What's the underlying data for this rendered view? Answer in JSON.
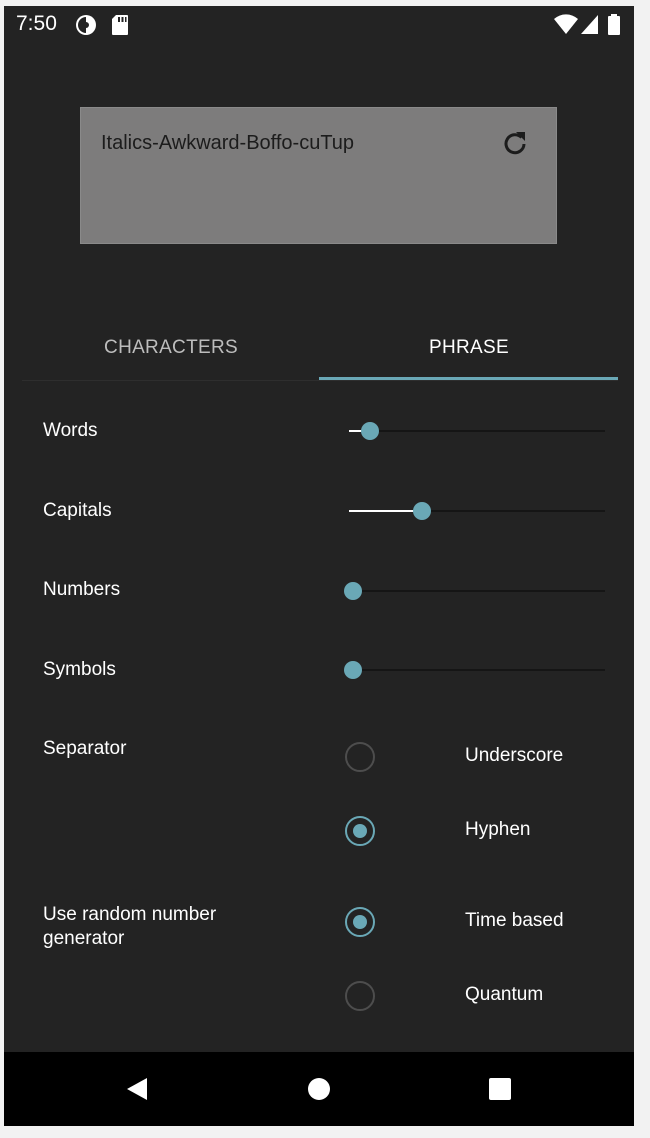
{
  "status_bar": {
    "time": "7:50",
    "icons": [
      "data-saver-icon",
      "sd-card-icon",
      "wifi-icon",
      "signal-icon",
      "battery-icon"
    ]
  },
  "password": {
    "value": "Italics-Awkward-Boffo-cuTup",
    "refresh_icon": "refresh-icon"
  },
  "tabs": [
    {
      "label": "CHARACTERS",
      "selected": false
    },
    {
      "label": "PHRASE",
      "selected": true
    }
  ],
  "settings": {
    "words": {
      "label": "Words",
      "value_fraction": 0.07
    },
    "capitals": {
      "label": "Capitals",
      "value_fraction": 0.28
    },
    "numbers": {
      "label": "Numbers",
      "value_fraction": 0.0
    },
    "symbols": {
      "label": "Symbols",
      "value_fraction": 0.0
    },
    "separator": {
      "label": "Separator",
      "options": [
        {
          "label": "Underscore",
          "checked": false
        },
        {
          "label": "Hyphen",
          "checked": true
        }
      ]
    },
    "rng": {
      "label": "Use random number generator",
      "options": [
        {
          "label": "Time based",
          "checked": true
        },
        {
          "label": "Quantum",
          "checked": false
        }
      ]
    }
  },
  "nav_bar": {
    "icons": [
      "back-icon",
      "home-icon",
      "recents-icon"
    ]
  },
  "colors": {
    "accent": "#6aa8b6",
    "background": "#232323",
    "password_box": "#7d7c7c"
  }
}
